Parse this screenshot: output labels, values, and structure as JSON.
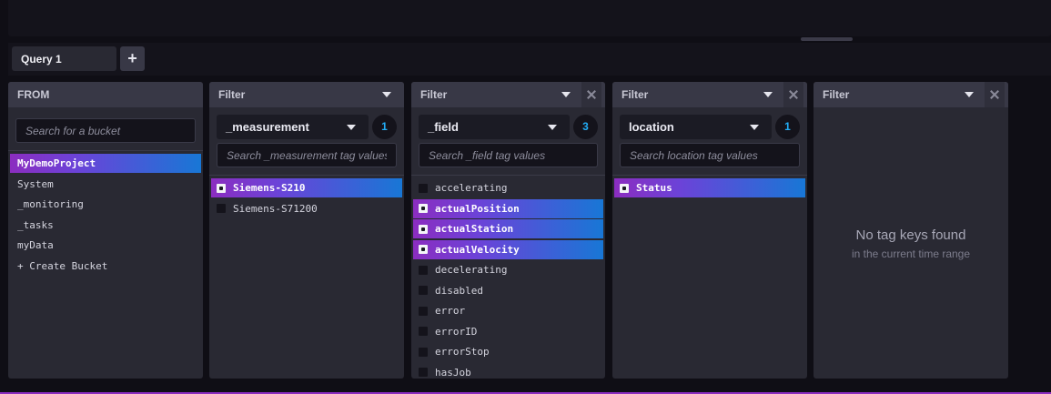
{
  "query_bar": {
    "tab_label": "Query 1",
    "add_label": "+"
  },
  "from": {
    "title": "FROM",
    "search_placeholder": "Search for a bucket",
    "buckets": [
      "MyDemoProject",
      "System",
      "_monitoring",
      "_tasks",
      "myData",
      "+ Create Bucket"
    ],
    "selected": "MyDemoProject"
  },
  "filters": [
    {
      "title": "Filter",
      "key": "_measurement",
      "count": "1",
      "search_placeholder": "Search _measurement tag values",
      "values": [
        {
          "label": "Siemens-S210",
          "selected": true
        },
        {
          "label": "Siemens-S71200",
          "selected": false
        }
      ]
    },
    {
      "title": "Filter",
      "key": "_field",
      "count": "3",
      "search_placeholder": "Search _field tag values",
      "values": [
        {
          "label": "accelerating",
          "selected": false
        },
        {
          "label": "actualPosition",
          "selected": true
        },
        {
          "label": "actualStation",
          "selected": true
        },
        {
          "label": "actualVelocity",
          "selected": true
        },
        {
          "label": "decelerating",
          "selected": false
        },
        {
          "label": "disabled",
          "selected": false
        },
        {
          "label": "error",
          "selected": false
        },
        {
          "label": "errorID",
          "selected": false
        },
        {
          "label": "errorStop",
          "selected": false
        },
        {
          "label": "hasJob",
          "selected": false
        }
      ]
    },
    {
      "title": "Filter",
      "key": "location",
      "count": "1",
      "search_placeholder": "Search location tag values",
      "values": [
        {
          "label": "Status",
          "selected": true
        }
      ]
    },
    {
      "title": "Filter",
      "empty_title": "No tag keys found",
      "empty_sub": "in the current time range"
    }
  ],
  "colors": {
    "accent_purple": "#8b2dc0",
    "accent_blue": "#1877d6",
    "count_blue": "#22adf6"
  }
}
